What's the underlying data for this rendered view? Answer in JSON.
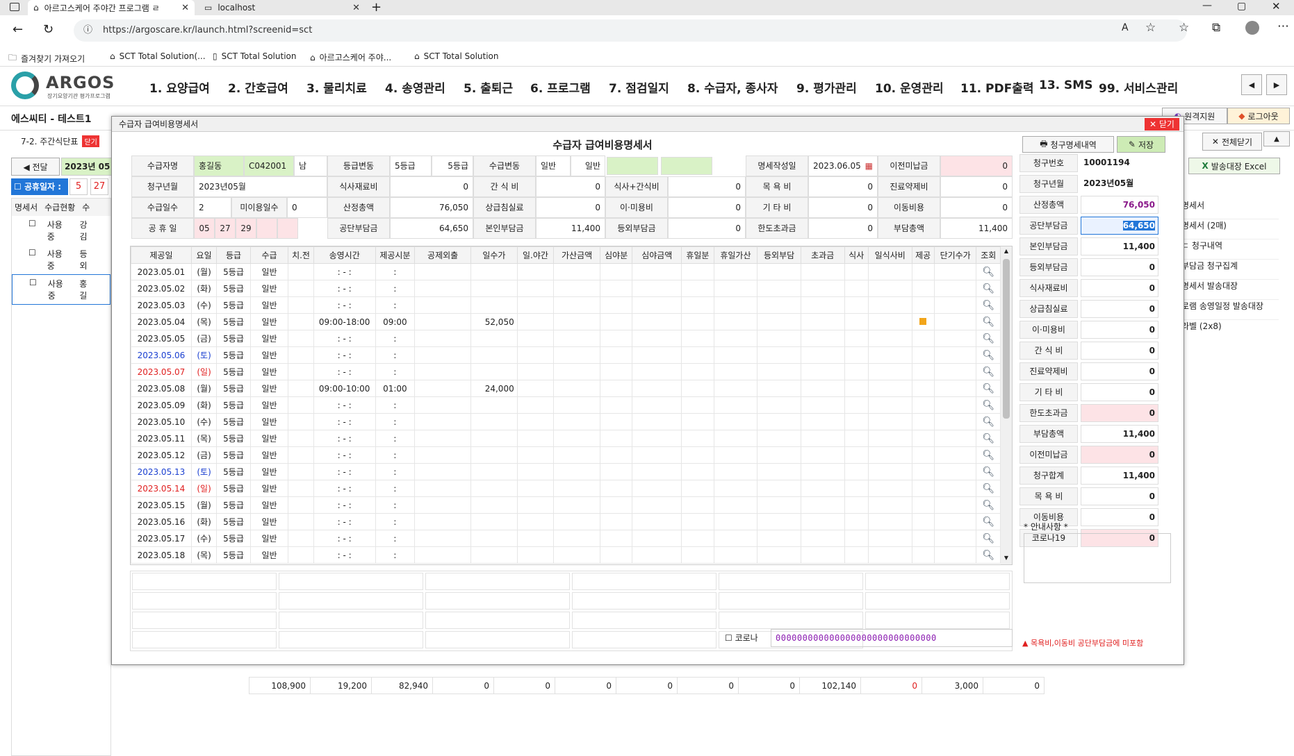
{
  "browser": {
    "tabs": [
      {
        "title": "아르고스케어 주야간 프로그램 ㄹ"
      },
      {
        "title": "localhost"
      }
    ],
    "url": "https://argoscare.kr/launch.html?screenid=sct",
    "bookmarks": [
      "즐겨찾기 가져오기",
      "SCT Total Solution(...",
      "SCT Total Solution",
      "아르고스케어 주야...",
      "SCT Total Solution"
    ]
  },
  "app": {
    "logo_text": "ARGOS",
    "logo_sub": "장기요양기관 평가프로그램",
    "menu": [
      "1. 요양급여",
      "2. 간호급여",
      "3. 물리치료",
      "4. 송영관리",
      "5. 출퇴근",
      "6. 프로그램",
      "7. 점검일지",
      "8. 수급자, 종사자",
      "9. 평가관리",
      "10. 운영관리",
      "11. PDF출력",
      "13. SMS",
      "99. 서비스관리"
    ],
    "org": "에스씨티 - 테스트1",
    "page_tab": "7-2. 주간식단표",
    "page_tab_close": "닫기",
    "prev_label": "◀ 전달",
    "month_value": "2023년 05월",
    "holiday_label": "공휴일자 :",
    "holiday_vals": [
      "5",
      "27"
    ],
    "list_headers": [
      "명세서",
      "수급현황",
      "수"
    ],
    "list_rows": [
      {
        "status": "사용중",
        "name": "강김"
      },
      {
        "status": "사용중",
        "name": "등외"
      },
      {
        "status": "사용중",
        "name": "홍길"
      }
    ],
    "right_buttons": [
      "전체닫기",
      "발송대장 Excel"
    ],
    "right_links": [
      "명세서",
      "명세서 (2매)",
      "ㄷ 청구내역",
      "부담금 청구집계",
      "명세서 발송대장",
      "로램 송영일정 발송대장",
      "라벨 (2x8)"
    ],
    "header_btns": [
      "원격지원",
      "로그아웃"
    ],
    "bottom_sums": [
      "108,900",
      "19,200",
      "82,940",
      "0",
      "0",
      "0",
      "0",
      "0",
      "0",
      "102,140",
      "0",
      "3,000",
      "0"
    ]
  },
  "modal": {
    "title": "수급자 급여비용명세서",
    "close_label": "닫기",
    "heading": "수급자 급여비용명세서",
    "btn_history": "청구명세내역",
    "btn_save": "저장",
    "info": {
      "name_label": "수급자명",
      "name": "홍길동",
      "code": "C042001",
      "gender": "남",
      "grade_change_label": "등급변동",
      "grade_a": "5등급",
      "grade_b": "5등급",
      "type_change_label": "수급변동",
      "type_a": "일반",
      "type_b": "일반",
      "issue_date_label": "명세작성일",
      "issue_date": "2023.06.05",
      "prev_unpaid_label": "이전미납금",
      "prev_unpaid": "0",
      "claim_month_label": "청구년월",
      "claim_month": "2023년05월",
      "meal_label": "식사재료비",
      "meal": "0",
      "snack_label": "간 식 비",
      "snack": "0",
      "meal_snack_label": "식사+간식비",
      "meal_snack": "0",
      "bath_label": "목 욕 비",
      "bath": "0",
      "med_label": "진료약제비",
      "med": "0",
      "days_label": "수급일수",
      "days": "2",
      "unused_label": "미이용일수",
      "unused": "0",
      "total_label": "산정총액",
      "total": "76,050",
      "room_label": "상급침실료",
      "room": "0",
      "hair_label": "이·미용비",
      "hair": "0",
      "etc_label": "기 타 비",
      "etc": "0",
      "move_label": "이동비용",
      "move": "0",
      "holiday_label": "공 휴 일",
      "holidays": [
        "05",
        "27",
        "29"
      ],
      "public_label": "공단부담금",
      "public": "64,650",
      "self_label": "본인부담금",
      "self": "11,400",
      "extra_label": "등외부담금",
      "extra": "0",
      "over_label": "한도초과금",
      "over": "0",
      "burden_label": "부담총액",
      "burden": "11,400"
    },
    "grid_headers": [
      "제공일",
      "요일",
      "등급",
      "수급",
      "치.전",
      "송영시간",
      "제공시분",
      "공제외출",
      "일수가",
      "일.야간",
      "가산금액",
      "심야분",
      "심야금액",
      "휴일분",
      "휴일가산",
      "등외부담",
      "초과금",
      "식사",
      "일식사비",
      "제공",
      "단기수가",
      "조회"
    ],
    "rows": [
      {
        "date": "2023.05.01",
        "dow": "(월)",
        "grade": "5등급",
        "type": "일반",
        "time": ": - :",
        "dur": ":",
        "fee": "",
        "color": ""
      },
      {
        "date": "2023.05.02",
        "dow": "(화)",
        "grade": "5등급",
        "type": "일반",
        "time": ": - :",
        "dur": ":",
        "fee": "",
        "color": ""
      },
      {
        "date": "2023.05.03",
        "dow": "(수)",
        "grade": "5등급",
        "type": "일반",
        "time": ": - :",
        "dur": ":",
        "fee": "",
        "color": ""
      },
      {
        "date": "2023.05.04",
        "dow": "(목)",
        "grade": "5등급",
        "type": "일반",
        "time": "09:00-18:00",
        "dur": "09:00",
        "fee": "52,050",
        "color": "",
        "mark": true
      },
      {
        "date": "2023.05.05",
        "dow": "(금)",
        "grade": "5등급",
        "type": "일반",
        "time": ": - :",
        "dur": ":",
        "fee": "",
        "color": ""
      },
      {
        "date": "2023.05.06",
        "dow": "(토)",
        "grade": "5등급",
        "type": "일반",
        "time": ": - :",
        "dur": ":",
        "fee": "",
        "color": "blue"
      },
      {
        "date": "2023.05.07",
        "dow": "(일)",
        "grade": "5등급",
        "type": "일반",
        "time": ": - :",
        "dur": ":",
        "fee": "",
        "color": "red"
      },
      {
        "date": "2023.05.08",
        "dow": "(월)",
        "grade": "5등급",
        "type": "일반",
        "time": "09:00-10:00",
        "dur": "01:00",
        "fee": "24,000",
        "color": ""
      },
      {
        "date": "2023.05.09",
        "dow": "(화)",
        "grade": "5등급",
        "type": "일반",
        "time": ": - :",
        "dur": ":",
        "fee": "",
        "color": ""
      },
      {
        "date": "2023.05.10",
        "dow": "(수)",
        "grade": "5등급",
        "type": "일반",
        "time": ": - :",
        "dur": ":",
        "fee": "",
        "color": ""
      },
      {
        "date": "2023.05.11",
        "dow": "(목)",
        "grade": "5등급",
        "type": "일반",
        "time": ": - :",
        "dur": ":",
        "fee": "",
        "color": ""
      },
      {
        "date": "2023.05.12",
        "dow": "(금)",
        "grade": "5등급",
        "type": "일반",
        "time": ": - :",
        "dur": ":",
        "fee": "",
        "color": ""
      },
      {
        "date": "2023.05.13",
        "dow": "(토)",
        "grade": "5등급",
        "type": "일반",
        "time": ": - :",
        "dur": ":",
        "fee": "",
        "color": "blue"
      },
      {
        "date": "2023.05.14",
        "dow": "(일)",
        "grade": "5등급",
        "type": "일반",
        "time": ": - :",
        "dur": ":",
        "fee": "",
        "color": "red"
      },
      {
        "date": "2023.05.15",
        "dow": "(월)",
        "grade": "5등급",
        "type": "일반",
        "time": ": - :",
        "dur": ":",
        "fee": "",
        "color": ""
      },
      {
        "date": "2023.05.16",
        "dow": "(화)",
        "grade": "5등급",
        "type": "일반",
        "time": ": - :",
        "dur": ":",
        "fee": "",
        "color": ""
      },
      {
        "date": "2023.05.17",
        "dow": "(수)",
        "grade": "5등급",
        "type": "일반",
        "time": ": - :",
        "dur": ":",
        "fee": "",
        "color": ""
      },
      {
        "date": "2023.05.18",
        "dow": "(목)",
        "grade": "5등급",
        "type": "일반",
        "time": ": - :",
        "dur": ":",
        "fee": "",
        "color": ""
      }
    ],
    "corona_label": "코로나",
    "corona_value": "000000000000000000000000000000",
    "summary": [
      {
        "label": "청구번호",
        "value": "10001194",
        "style": "plain"
      },
      {
        "label": "청구년월",
        "value": "2023년05월",
        "style": "plain"
      },
      {
        "label": "산정총액",
        "value": "76,050",
        "style": "purple"
      },
      {
        "label": "공단부담금",
        "value": "64,650",
        "style": "selected"
      },
      {
        "label": "본인부담금",
        "value": "11,400",
        "style": "num"
      },
      {
        "label": "등외부담금",
        "value": "0",
        "style": "num"
      },
      {
        "label": "식사재료비",
        "value": "0",
        "style": "num"
      },
      {
        "label": "상급침실료",
        "value": "0",
        "style": "num"
      },
      {
        "label": "이·미용비",
        "value": "0",
        "style": "num"
      },
      {
        "label": "간 식 비",
        "value": "0",
        "style": "num"
      },
      {
        "label": "진료약제비",
        "value": "0",
        "style": "num"
      },
      {
        "label": "기 타 비",
        "value": "0",
        "style": "num"
      },
      {
        "label": "한도초과금",
        "value": "0",
        "style": "pink"
      },
      {
        "label": "부담총액",
        "value": "11,400",
        "style": "numb"
      },
      {
        "label": "이전미납금",
        "value": "0",
        "style": "pink"
      },
      {
        "label": "청구합계",
        "value": "11,400",
        "style": "numb"
      },
      {
        "label": "목 욕 비",
        "value": "0",
        "style": "num"
      },
      {
        "label": "이동비용",
        "value": "0",
        "style": "num"
      },
      {
        "label": "코로나19",
        "value": "0",
        "style": "pink"
      }
    ],
    "notice_label": "* 안내사항 *",
    "notice_warn": "▲ 목욕비,이동비 공단부담금에 미포함"
  }
}
